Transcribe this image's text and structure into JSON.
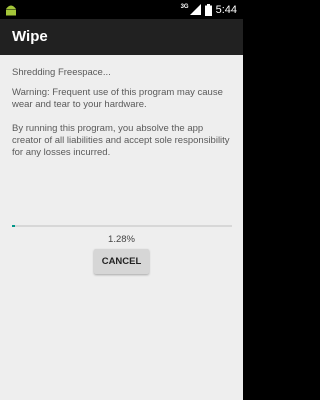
{
  "status_bar": {
    "network": "3G",
    "time": "5:44"
  },
  "app_bar": {
    "title": "Wipe"
  },
  "main": {
    "status": "Shredding Freespace...",
    "warning": "Warning: Frequent use of this program may cause wear and tear to your hardware.",
    "liability": "By running this program, you absolve the app creator of all liabilities and accept sole responsibility for any losses incurred.",
    "progress_percent": 1.28,
    "progress_label": "1.28%",
    "cancel_label": "CANCEL"
  },
  "colors": {
    "accent": "#009688",
    "app_bar": "#212121",
    "background": "#eeeeee"
  }
}
